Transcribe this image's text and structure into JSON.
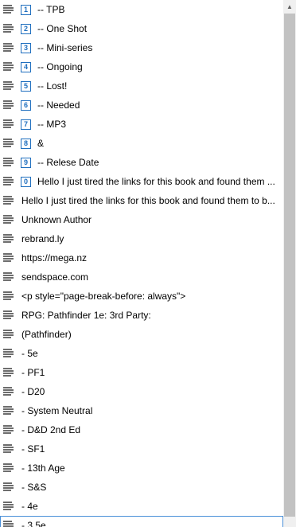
{
  "rows": [
    {
      "badge": "1",
      "label": " -- TPB"
    },
    {
      "badge": "2",
      "label": " -- One Shot"
    },
    {
      "badge": "3",
      "label": " -- Mini-series"
    },
    {
      "badge": "4",
      "label": " -- Ongoing"
    },
    {
      "badge": "5",
      "label": " -- Lost!"
    },
    {
      "badge": "6",
      "label": " -- Needed"
    },
    {
      "badge": "7",
      "label": " -- MP3"
    },
    {
      "badge": "8",
      "label": " &"
    },
    {
      "badge": "9",
      "label": " -- Relese Date"
    },
    {
      "badge": "0",
      "label": "Hello I just tired the links for this book and found them ..."
    },
    {
      "label": "Hello I just tired the links for this book and found them to b..."
    },
    {
      "label": "Unknown Author"
    },
    {
      "label": "rebrand.ly"
    },
    {
      "label": "https://mega.nz"
    },
    {
      "label": "sendspace.com"
    },
    {
      "label": "<p style=\"page-break-before: always\">"
    },
    {
      "label": "RPG: Pathfinder 1e: 3rd Party:"
    },
    {
      "label": "(Pathfinder)"
    },
    {
      "label": " - 5e"
    },
    {
      "label": " - PF1"
    },
    {
      "label": " - D20"
    },
    {
      "label": " - System Neutral"
    },
    {
      "label": " - D&D 2nd  Ed"
    },
    {
      "label": " - SF1"
    },
    {
      "label": " - 13th Age"
    },
    {
      "label": " - S&S"
    },
    {
      "label": " - 4e"
    },
    {
      "label": " - 3.5e"
    }
  ],
  "scrollbar": {
    "up_arrow_icon": "triangle-up"
  }
}
